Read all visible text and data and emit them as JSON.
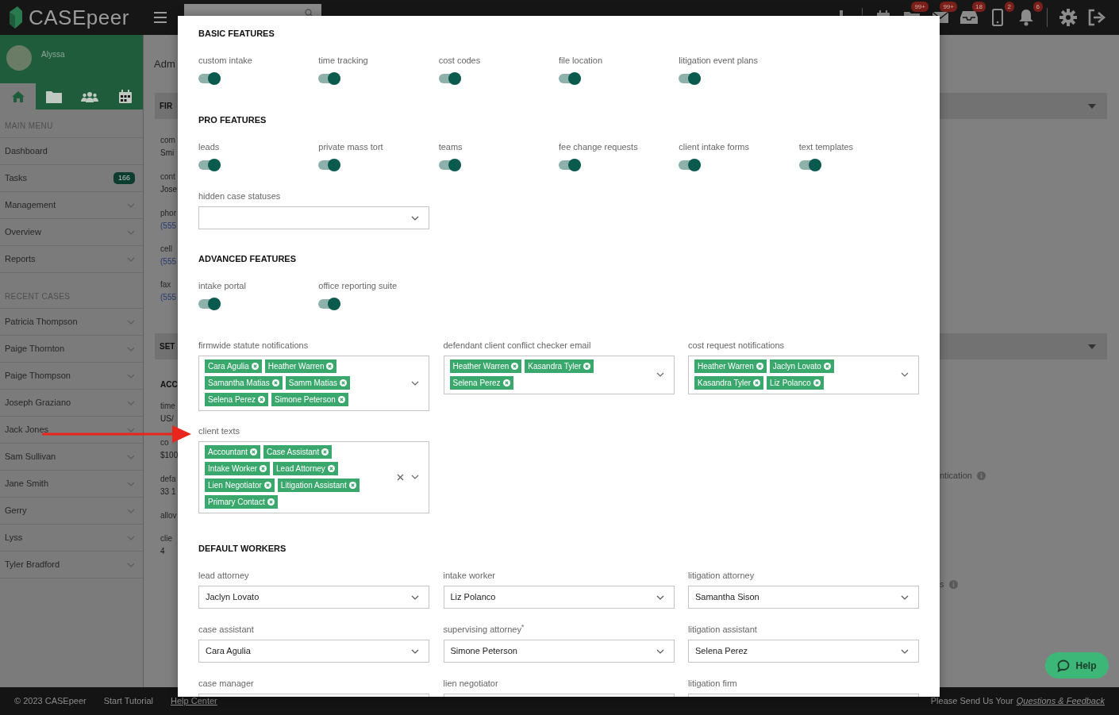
{
  "header": {
    "logo": "CASEpeer",
    "icon_groups": [
      [
        {
          "kind": "plus"
        }
      ],
      [
        {
          "kind": "calendar"
        },
        {
          "kind": "folder",
          "badge": "99+"
        },
        {
          "kind": "mail",
          "badge": "99+"
        },
        {
          "kind": "inbox",
          "badge": "18"
        },
        {
          "kind": "phone",
          "badge": "2"
        },
        {
          "kind": "bell",
          "badge": "6"
        }
      ],
      [
        {
          "kind": "gear"
        },
        {
          "kind": "logout"
        }
      ]
    ]
  },
  "sidebar": {
    "user": "Alyssa",
    "nav": [
      {
        "kind": "home",
        "selected": true
      },
      {
        "kind": "folder",
        "selected": false
      },
      {
        "kind": "users",
        "selected": false
      },
      {
        "kind": "calendar",
        "selected": false
      }
    ],
    "sections": [
      {
        "heading": "MAIN MENU",
        "items": [
          {
            "label": "Dashboard",
            "expandable": false
          },
          {
            "label": "Tasks",
            "badge": "166",
            "expandable": false
          },
          {
            "label": "Management",
            "expandable": true
          },
          {
            "label": "Overview",
            "expandable": true
          },
          {
            "label": "Reports",
            "expandable": true
          }
        ]
      },
      {
        "heading": "RECENT CASES",
        "items": [
          {
            "label": "Patricia Thompson",
            "expandable": true
          },
          {
            "label": "Paige Thornton",
            "expandable": true
          },
          {
            "label": "Paige Thompson",
            "expandable": true
          },
          {
            "label": "Joseph Graziano",
            "expandable": true
          },
          {
            "label": "Jack Jones",
            "expandable": true
          },
          {
            "label": "Sam Sullivan",
            "expandable": true
          },
          {
            "label": "Jane Smith",
            "expandable": true
          },
          {
            "label": "Gerry",
            "expandable": true
          },
          {
            "label": "Lyss",
            "expandable": true
          },
          {
            "label": "Tyler Bradford",
            "expandable": true
          }
        ]
      }
    ]
  },
  "background": {
    "left": [
      {
        "kind": "heading",
        "text": "Adm"
      },
      {
        "kind": "panel",
        "text": "FIR"
      },
      {
        "kind": "label",
        "text": "com"
      },
      {
        "kind": "value",
        "text": "Smi"
      },
      {
        "kind": "label",
        "text": "cont"
      },
      {
        "kind": "value",
        "text": "Jose"
      },
      {
        "kind": "label",
        "text": "phor"
      },
      {
        "kind": "link",
        "text": "(555"
      },
      {
        "kind": "label",
        "text": "cell"
      },
      {
        "kind": "link",
        "text": "(555"
      },
      {
        "kind": "label",
        "text": "fax"
      },
      {
        "kind": "link",
        "text": "(555"
      },
      {
        "kind": "panel",
        "text": "SET"
      },
      {
        "kind": "section",
        "text": "ACC"
      },
      {
        "kind": "label",
        "text": "time"
      },
      {
        "kind": "value",
        "text": "US/"
      },
      {
        "kind": "label",
        "text": "co"
      },
      {
        "kind": "value",
        "text": "$100"
      },
      {
        "kind": "label",
        "text": "defa"
      },
      {
        "kind": "value",
        "text": "33 1"
      },
      {
        "kind": "label",
        "text": "allov"
      },
      {
        "kind": "label",
        "text": "clie"
      },
      {
        "kind": "value",
        "text": "4"
      }
    ],
    "right": [
      {
        "kind": "panel"
      },
      {
        "kind": "panel"
      },
      {
        "kind": "info_text",
        "text": "ntication"
      },
      {
        "kind": "info_text",
        "text": "s"
      }
    ]
  },
  "modal": {
    "blocks": [
      {
        "kind": "heading",
        "text": "BASIC FEATURES"
      },
      {
        "kind": "toggles",
        "items": [
          {
            "label": "custom intake",
            "on": true
          },
          {
            "label": "time tracking",
            "on": true
          },
          {
            "label": "cost codes",
            "on": true
          },
          {
            "label": "file location",
            "on": true
          },
          {
            "label": "litigation event plans",
            "on": true
          }
        ]
      },
      {
        "kind": "heading",
        "text": "PRO FEATURES"
      },
      {
        "kind": "toggles",
        "items": [
          {
            "label": "leads",
            "on": true
          },
          {
            "label": "private mass tort",
            "on": true
          },
          {
            "label": "teams",
            "on": true
          },
          {
            "label": "fee change requests",
            "on": true
          },
          {
            "label": "client intake forms",
            "on": true
          },
          {
            "label": "text templates",
            "on": true
          }
        ]
      },
      {
        "kind": "selects",
        "items": [
          {
            "label": "hidden case statuses"
          }
        ]
      },
      {
        "kind": "heading",
        "text": "ADVANCED FEATURES"
      },
      {
        "kind": "toggles",
        "items": [
          {
            "label": "intake portal",
            "on": true
          },
          {
            "label": "office reporting suite",
            "on": true
          }
        ]
      },
      {
        "kind": "multiselects",
        "items": [
          {
            "label": "firmwide statute notifications",
            "clearable": false,
            "tags": [
              "Cara Agulia",
              "Heather Warren",
              "Samantha Matias",
              "Samm Matias",
              "Selena Perez",
              "Simone Peterson"
            ]
          },
          {
            "label": "defendant client conflict checker email",
            "clearable": false,
            "tags": [
              "Heather Warren",
              "Kasandra Tyler",
              "Selena Perez"
            ]
          },
          {
            "label": "cost request notifications",
            "clearable": false,
            "tags": [
              "Heather Warren",
              "Jaclyn Lovato",
              "Kasandra Tyler",
              "Liz Polanco"
            ]
          }
        ]
      },
      {
        "kind": "multiselects",
        "items": [
          {
            "label": "client texts",
            "clearable": true,
            "tags": [
              "Accountant",
              "Case Assistant",
              "Intake Worker",
              "Lead Attorney",
              "Lien Negotiator",
              "Litigation Assistant",
              "Primary Contact"
            ]
          }
        ]
      },
      {
        "kind": "heading",
        "text": "DEFAULT WORKERS"
      },
      {
        "kind": "selects",
        "items": [
          {
            "label": "lead attorney",
            "value": "Jaclyn Lovato"
          },
          {
            "label": "intake worker",
            "value": "Liz Polanco"
          },
          {
            "label": "litigation attorney",
            "value": "Samantha Sison"
          }
        ]
      },
      {
        "kind": "selects",
        "items": [
          {
            "label": "case assistant",
            "value": "Cara Agulia"
          },
          {
            "label": "supervising attorney$^{*}$",
            "value": "Simone Peterson"
          },
          {
            "label": "litigation assistant",
            "value": "Selena Perez"
          }
        ]
      },
      {
        "kind": "selects",
        "items": [
          {
            "label": "case manager"
          },
          {
            "label": "lien negotiator"
          },
          {
            "label": "litigation firm"
          }
        ]
      }
    ]
  },
  "help_button": "Help",
  "footer": {
    "copyright": "© 2023 CASEpeer",
    "links": [
      {
        "text": "Start Tutorial",
        "underlined": false
      },
      {
        "text": "Help Center",
        "underlined": true
      }
    ],
    "feedback_prompt": "Please Send Us Your",
    "feedback_link": "Questions & Feedback"
  }
}
